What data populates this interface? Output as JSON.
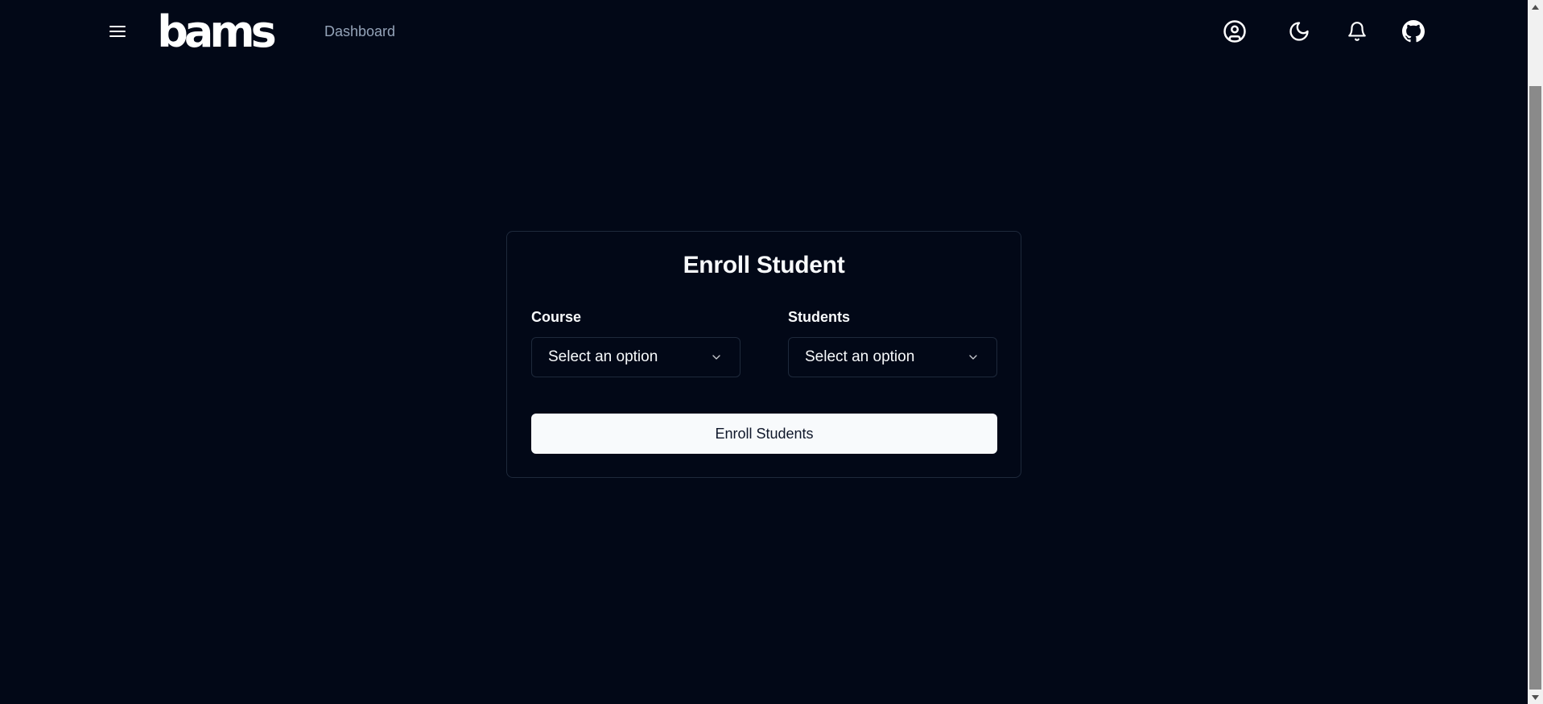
{
  "header": {
    "logo_text": "bams",
    "nav_link": "Dashboard",
    "icons": {
      "menu": "menu-icon",
      "account": "user-circle-icon",
      "theme": "moon-icon",
      "notifications": "bell-icon",
      "github": "github-icon"
    }
  },
  "form": {
    "title": "Enroll Student",
    "course": {
      "label": "Course",
      "value": "Select an option"
    },
    "students": {
      "label": "Students",
      "value": "Select an option"
    },
    "submit_label": "Enroll Students"
  },
  "colors": {
    "background": "#020817",
    "border": "#1e293b",
    "text": "#f8fafc",
    "muted_text": "#94a3b8",
    "button_bg": "#f8fafc",
    "button_text": "#0f172a"
  }
}
